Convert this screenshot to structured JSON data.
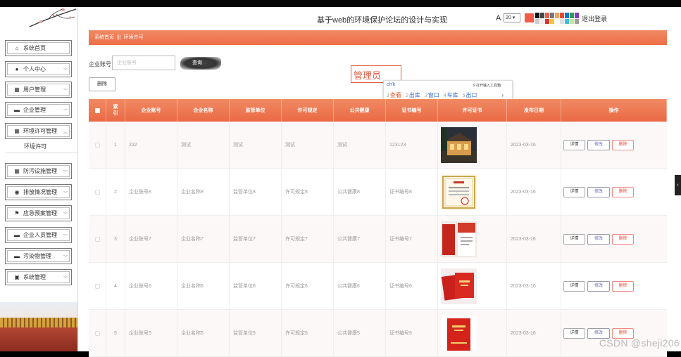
{
  "site_title": "基于web的环境保护论坛的设计与实现",
  "toolbar": {
    "font_icon": "A",
    "font_size": "20",
    "main_swatch": "#f25b4a",
    "swatches": [
      "#111111",
      "#444444",
      "#f25b4a",
      "#777777",
      "#f0a35e",
      "#e04c3a",
      "#1a73c9",
      "#2a9d5c",
      "#7b3fb8",
      "#cccccc",
      "#eeeeee",
      "#dd3333",
      "#f6c343",
      "#ffffff",
      "#e0e0e0",
      "#3ac1e0",
      "#c8e6a0",
      "#9e9e9e"
    ],
    "logout": "退出登录"
  },
  "sidebar": {
    "items": [
      {
        "label": "系统首页",
        "icon": "home-icon",
        "glyph": "⌂",
        "expandable": false
      },
      {
        "label": "个人中心",
        "icon": "user-icon",
        "glyph": "●",
        "expandable": true
      },
      {
        "label": "用户管理",
        "icon": "grid-icon",
        "glyph": "▦",
        "expandable": true
      },
      {
        "label": "企业管理",
        "icon": "monitor-icon",
        "glyph": "▬",
        "expandable": true
      },
      {
        "label": "环境许可管理",
        "icon": "grid-icon",
        "glyph": "▦",
        "expandable": true,
        "expanded": true
      },
      {
        "label": "防污设施管理",
        "icon": "grid-icon",
        "glyph": "▦",
        "expandable": true
      },
      {
        "label": "排放情况管理",
        "icon": "map-pin-icon",
        "glyph": "◉",
        "expandable": true
      },
      {
        "label": "应急预案管理",
        "icon": "flag-icon",
        "glyph": "⚑",
        "expandable": true
      },
      {
        "label": "企业人员管理",
        "icon": "monitor-icon",
        "glyph": "▬",
        "expandable": true
      },
      {
        "label": "污染物管理",
        "icon": "monitor-icon",
        "glyph": "▬",
        "expandable": true
      },
      {
        "label": "系统管理",
        "icon": "gear-icon",
        "glyph": "▣",
        "expandable": true
      }
    ],
    "sub_item": "环境许可"
  },
  "breadcrumb": {
    "home": "系统首页",
    "sep": "|||",
    "current": "环境许可"
  },
  "search": {
    "label": "企业账号",
    "placeholder": "企业账号",
    "query_button": "查询"
  },
  "delete_button": "删除",
  "admin_overlay": "管理员",
  "ime": {
    "composition": "ch'k",
    "hint": "9 打开输入工具箱",
    "candidates": [
      {
        "n": "1",
        "text": "查看"
      },
      {
        "n": "2",
        "text": "出库"
      },
      {
        "n": "3",
        "text": "窗口"
      },
      {
        "n": "4",
        "text": "车库"
      },
      {
        "n": "5",
        "text": "出口"
      }
    ],
    "more": "›"
  },
  "table": {
    "headers": [
      "",
      "索引",
      "企业账号",
      "企业名称",
      "监管单位",
      "许可规定",
      "公共健康",
      "证书编号",
      "许可证书",
      "发布日期",
      "操作"
    ],
    "rows": [
      {
        "idx": "1",
        "account": "222",
        "name": "测试",
        "unit": "测试",
        "rule": "测试",
        "health": "测试",
        "cert_no": "123123",
        "image": "building",
        "date": "2023-03-16"
      },
      {
        "idx": "2",
        "account": "企业账号8",
        "name": "企业名称8",
        "unit": "监管单位8",
        "rule": "许可规定8",
        "health": "公共健康8",
        "cert_no": "证书编号8",
        "image": "certificate",
        "date": "2023-03-16"
      },
      {
        "idx": "3",
        "account": "企业账号7",
        "name": "企业名称7",
        "unit": "监管单位7",
        "rule": "许可规定7",
        "health": "公共健康7",
        "cert_no": "证书编号7",
        "image": "red-booklet",
        "date": "2023-03-16"
      },
      {
        "idx": "4",
        "account": "企业账号6",
        "name": "企业名称6",
        "unit": "监管单位6",
        "rule": "许可规定6",
        "health": "公共健康6",
        "cert_no": "证书编号6",
        "image": "red-cards",
        "date": "2023-03-16"
      },
      {
        "idx": "5",
        "account": "企业账号5",
        "name": "企业名称5",
        "unit": "监管单位5",
        "rule": "许可规定5",
        "health": "公共健康5",
        "cert_no": "证书编号5",
        "image": "red-cover",
        "date": "2023-03-16"
      }
    ],
    "actions": {
      "detail": "详情",
      "edit": "修改",
      "delete": "删除"
    }
  },
  "side_tab": "‹",
  "watermark": "CSDN @sheji206"
}
